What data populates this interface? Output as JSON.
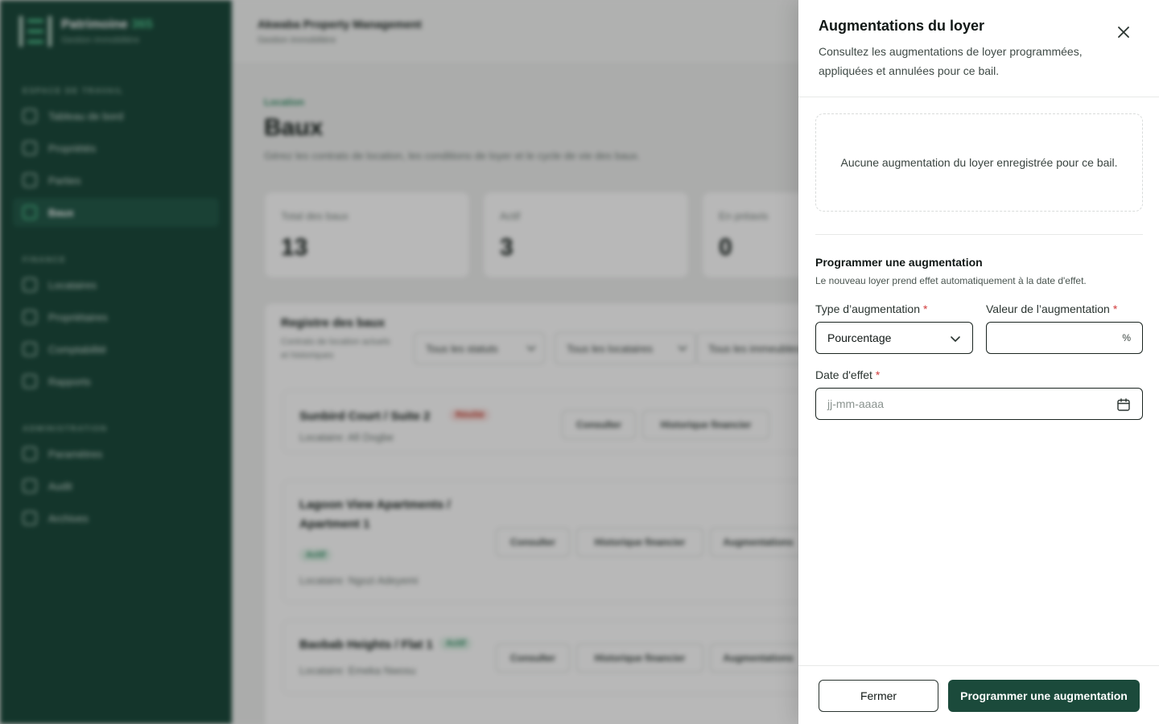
{
  "brand": {
    "name": "Patrimoine",
    "name_accent": "365",
    "subtitle": "Gestion immobilière"
  },
  "sidebar": {
    "sections": [
      {
        "label": "ESPACE DE TRAVAIL",
        "items": [
          {
            "label": "Tableau de bord",
            "icon": "grid-icon"
          },
          {
            "label": "Propriétés",
            "icon": "building-icon"
          },
          {
            "label": "Parties",
            "icon": "user-icon"
          },
          {
            "label": "Baux",
            "icon": "document-icon",
            "active": true
          }
        ]
      },
      {
        "label": "FINANCE",
        "items": [
          {
            "label": "Locataires",
            "icon": "users-icon"
          },
          {
            "label": "Propriétaires",
            "icon": "owner-icon"
          },
          {
            "label": "Comptabilité",
            "icon": "ledger-icon"
          },
          {
            "label": "Rapports",
            "icon": "chart-icon"
          }
        ]
      },
      {
        "label": "ADMINISTRATION",
        "items": [
          {
            "label": "Paramètres",
            "icon": "gear-icon"
          },
          {
            "label": "Audit",
            "icon": "shield-icon"
          },
          {
            "label": "Archives",
            "icon": "archive-icon"
          }
        ]
      }
    ]
  },
  "topbar": {
    "title": "Akwaba Property Management",
    "subtitle": "Gestion immobilière"
  },
  "page": {
    "breadcrumb": "Location",
    "title": "Baux",
    "description": "Gérez les contrats de location, les conditions de loyer et le cycle de vie des baux."
  },
  "stats": [
    {
      "label": "Total des baux",
      "value": "13"
    },
    {
      "label": "Actif",
      "value": "3"
    },
    {
      "label": "En préavis",
      "value": "0"
    }
  ],
  "registry": {
    "title": "Registre des baux",
    "subtitle": "Contrats de location actuels et historiques",
    "filters": [
      "Tous les statuts",
      "Tous les locataires",
      "Tous les immeubles"
    ],
    "leases": [
      {
        "title": "Sunbird Court / Suite 2",
        "status": "Résilié",
        "tenant": "Locataire: Afi Dogbe"
      },
      {
        "title": "Lagoon View Apartments / Apartment 1",
        "status": "Actif",
        "tenant": "Locataire: Ngozi Adeyemi"
      },
      {
        "title": "Baobab Heights / Flat 1",
        "status": "Actif",
        "tenant": "Locataire: Emeka Nwosu"
      }
    ],
    "actions": {
      "view": "Consulter",
      "history": "Historique financier",
      "increase": "Augmentations"
    }
  },
  "drawer": {
    "title": "Augmentations du loyer",
    "description": "Consultez les augmentations de loyer programmées, appliquées et annulées pour ce bail.",
    "empty_message": "Aucune augmentation du loyer enregistrée pour ce bail.",
    "form": {
      "title": "Programmer une augmentation",
      "hint": "Le nouveau loyer prend effet automatiquement à la date d'effet.",
      "type_label": "Type d’augmentation",
      "type_value": "Pourcentage",
      "value_label": "Valeur de l’augmentation",
      "value_value": "",
      "value_suffix": "%",
      "date_label": "Date d'effet",
      "date_placeholder": "jj-mm-aaaa",
      "required_mark": "*"
    },
    "footer": {
      "close_label": "Fermer",
      "submit_label": "Programmer une augmentation"
    }
  },
  "colors": {
    "sidebar_bg": "#1c4a3c",
    "accent": "#4fc08d",
    "primary_button": "#1b4a3b",
    "required": "#d13b3b"
  }
}
